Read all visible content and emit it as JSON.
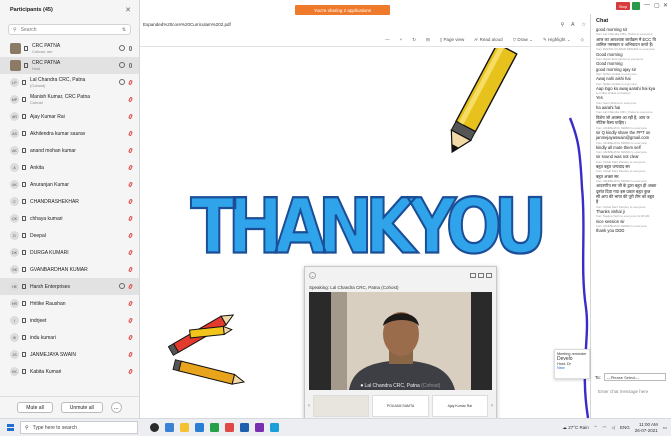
{
  "participants": {
    "title": "Participants (45)",
    "search_placeholder": "Search",
    "rows": [
      {
        "initials": "",
        "name": "CRC PATNA",
        "sub": "Cohost, me",
        "photo": true
      },
      {
        "initials": "",
        "name": "CRC PATNA",
        "sub": "Host",
        "photo": true
      },
      {
        "initials": "LP",
        "name": "Lal Chandra CRC, Patna",
        "sub": "(Cohost)"
      },
      {
        "initials": "MP",
        "name": "Manish Kumar, CRC Patna",
        "sub": "Cohost"
      },
      {
        "initials": "AR",
        "name": "Ajay Kumar Rai",
        "sub": ""
      },
      {
        "initials": "AS",
        "name": "Akhilendra kumar saurav",
        "sub": ""
      },
      {
        "initials": "AK",
        "name": "anand mohan kumar",
        "sub": ""
      },
      {
        "initials": "A",
        "name": "Ankita",
        "sub": ""
      },
      {
        "initials": "AK",
        "name": "Anuranjan Kumar",
        "sub": ""
      },
      {
        "initials": "C",
        "name": "CHANDRASHEKHAR",
        "sub": ""
      },
      {
        "initials": "CK",
        "name": "chhaya kumari",
        "sub": ""
      },
      {
        "initials": "D",
        "name": "Deepal",
        "sub": ""
      },
      {
        "initials": "DK",
        "name": "DURGA KUMARI",
        "sub": ""
      },
      {
        "initials": "GK",
        "name": "GVANBARDHAN KUMAR",
        "sub": ""
      },
      {
        "initials": "HE",
        "name": "Harsh Enterprises",
        "sub": ""
      },
      {
        "initials": "HR",
        "name": "Hritike Raushan",
        "sub": ""
      },
      {
        "initials": "I",
        "name": "indrjeet",
        "sub": ""
      },
      {
        "initials": "IK",
        "name": "indu kumari",
        "sub": ""
      },
      {
        "initials": "JS",
        "name": "JANMEJAYA SWAIN",
        "sub": ""
      },
      {
        "initials": "KK",
        "name": "Kabita Kumari",
        "sub": ""
      }
    ],
    "mute_all": "Mute all",
    "unmute_all": "Unmute all",
    "more": "..."
  },
  "banner": {
    "sharing": "You're sharing 2 applications",
    "stop": "Stop"
  },
  "pdf": {
    "tab_title": "Expanded%20core%20Curriculam%202.pdf",
    "zoom_minus": "—",
    "zoom_plus": "+",
    "page_view": "Page view",
    "read_aloud": "Read aloud",
    "draw": "Draw",
    "highlight": "Highlight",
    "thank_you": "THANKYOU"
  },
  "video": {
    "speaking": "Speaking: Lal Chandra CRC, Patna (Cohost)",
    "name": "Lal Chandra CRC, Patna",
    "cohost": "(Cohost)",
    "thumbs": [
      "",
      "POUJAM SAMTA",
      "Ajay Kumar Rai"
    ]
  },
  "chat": {
    "title": "Chat",
    "messages": [
      {
        "from": "",
        "text": "good morning sir"
      },
      {
        "from": "from Lal Chandra CRC, Patna to everyone",
        "text": "आज का आवश्यक कार्यक्रम में ECC वि"
      },
      {
        "from": "",
        "text": "शामिल नमस्कार व अभिवादन करते हैं।"
      },
      {
        "from": "from MANISH KUMAR MISHRA to everyone",
        "text": "Good morning"
      },
      {
        "from": "from Harsh Enterprises to everyone",
        "text": "Good morning"
      },
      {
        "from": "",
        "text": "good morning ajay sir"
      },
      {
        "from": "from hritike shukla to everyone",
        "text": "Awaj nahi aishi hai"
      },
      {
        "from": "from hritike shukla to everyone",
        "text": "Aap logo ko awaj aarahi hai kya"
      },
      {
        "from": "to Indira shukla (privately)",
        "text": "Yes"
      },
      {
        "from": "from Sonu Mishra to everyone",
        "text": "ha aarahi hai"
      },
      {
        "from": "from Lal Chandra CRC, Patna to everyone",
        "text": "विशेष जो अवसर आ रही है, आप ज"
      },
      {
        "from": "",
        "text": "नोटिस कैसा चाहिए।"
      },
      {
        "from": "from JANMEJAYA SWAIN to everyone",
        "text": "sir Q kindly share the PPT on"
      },
      {
        "from": "",
        "text": "janmejayaswain@gmail.com"
      },
      {
        "from": "from JANMEJAYA SWAIN to everyone",
        "text": "kindly all mute them self"
      },
      {
        "from": "from JANMEJAYA SWAIN to everyone",
        "text": "sir sound was not clear"
      },
      {
        "from": "from Vishal Sant Pandey to everyone",
        "text": "बहुत बहुत धन्यवाद सर"
      },
      {
        "from": "from Vishal Sant Pandey to everyone",
        "text": "बहुत अच्छा सर"
      },
      {
        "from": "from JANMEJAYA SWAIN to everyone",
        "text": "आदरणीय सर जी के द्वारा बहुत ही अच्छा"
      },
      {
        "from": "",
        "text": "दृष्टांत दिया गया इस प्रकार बहुत कुछ"
      },
      {
        "from": "",
        "text": "सी आप की भाषा की पूरी टीम को बहुत"
      },
      {
        "from": "",
        "text": "है"
      },
      {
        "from": "from Vishal Sant Pandey to everyone",
        "text": "Thanks vishal ji"
      },
      {
        "from": "from Tapang Seth to everyone  11:00 AM",
        "text": "nice session sir"
      },
      {
        "from": "from JANMEJAYA SWAIN to everyone",
        "text": "thank you DDD"
      }
    ],
    "to_label": "To:",
    "to_select": "---Please Select---",
    "input_placeholder": "Enter chat message here"
  },
  "reminder": {
    "title": "Meeting reminder",
    "line1": "Develo",
    "line2": "Host: Dr",
    "new": "New"
  },
  "taskbar": {
    "search_placeholder": "Type here to search",
    "weather": "27°C Rain",
    "lang": "ENG",
    "time": "11:00 AM",
    "date": "26-07-2021"
  }
}
